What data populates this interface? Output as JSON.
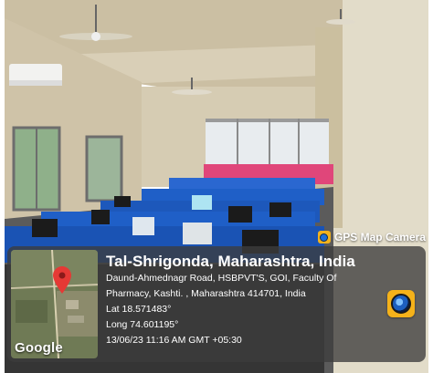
{
  "photo": {
    "subject": "computer lab interior",
    "colors": {
      "wall": "#d7cdb5",
      "ceiling": "#c8bea5",
      "partition": "#1f5fc7",
      "floor": "#5b5b5b",
      "curtain": "#e0467a"
    }
  },
  "gps_overlay": {
    "brand_label": "GPS Map Camera",
    "location_title": "Tal-Shrigonda, Maharashtra, India",
    "address_line_1": "Daund-Ahmednagr Road, HSBPVT'S, GOI, Faculty Of",
    "address_line_2": "Pharmacy, Kashti. , Maharashtra 414701, India",
    "latitude": "Lat 18.571483°",
    "longitude": "Long 74.601195°",
    "datetime": "13/06/23 11:16 AM GMT +05:30",
    "map_logo": "Google",
    "icons": {
      "pin": "location-pin-icon",
      "app": "gps-map-camera-icon"
    }
  }
}
